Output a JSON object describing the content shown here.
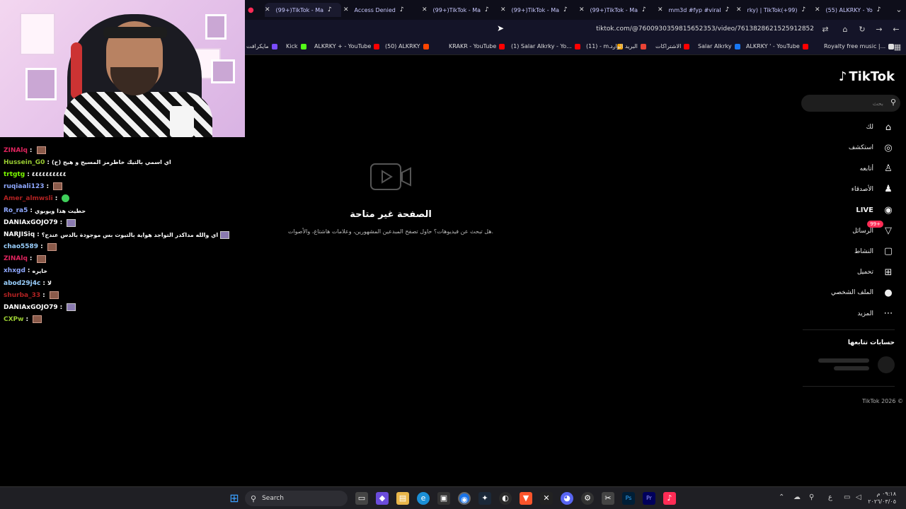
{
  "tabs": [
    {
      "label": "(99+)TikTok - Ma",
      "active": true
    },
    {
      "label": "Access Denied",
      "active": false
    },
    {
      "label": "(99+)TikTok - Ma",
      "active": false
    },
    {
      "label": "(99+)TikTok - Ma",
      "active": false
    },
    {
      "label": "(99+)TikTok - Ma",
      "active": false
    },
    {
      "label": "mm3d #fyp #viral",
      "active": false
    },
    {
      "label": "rky) | TikTok(+99)",
      "active": false
    },
    {
      "label": "(55) ALKRKY - Yo",
      "active": false
    }
  ],
  "url": "tiktok.com/@7600930359815652353/video/7613828621525912852",
  "bookmarks": [
    {
      "label": "مايكرافت",
      "color": "#7a4cff"
    },
    {
      "label": "Kick",
      "color": "#53fc18"
    },
    {
      "label": "ALKRKY + - YouTube",
      "color": "#ff0000"
    },
    {
      "label": "(50) ALKRKY",
      "color": "#ff4500"
    },
    {
      "label": "KRAKR - YouTube",
      "color": "#ff0000"
    },
    {
      "label": "(1) Salar Alkrky - Yo...",
      "color": "#ff0000"
    },
    {
      "label": "(11) - m...",
      "color": "#f4a100"
    },
    {
      "label": "البريد الوارد",
      "color": "#ea4335"
    },
    {
      "label": "الاشتراكات",
      "color": "#ff0000"
    },
    {
      "label": "Salar Alkrky",
      "color": "#1877f2"
    },
    {
      "label": "ALKRKY ' - YouTube",
      "color": "#ff0000"
    },
    {
      "label": "Royalty free music |...",
      "color": "#dddddd"
    }
  ],
  "tiktok": {
    "logo": "TikTok",
    "search_placeholder": "بحث",
    "nav": [
      {
        "label": "لك",
        "icon": "home-icon",
        "glyph": "⌂"
      },
      {
        "label": "استكشف",
        "icon": "compass-icon",
        "glyph": "◎"
      },
      {
        "label": "أتابعه",
        "icon": "user-follow-icon",
        "glyph": "♙"
      },
      {
        "label": "الأصدقاء",
        "icon": "friends-icon",
        "glyph": "♟"
      },
      {
        "label": "LIVE",
        "icon": "live-icon",
        "glyph": "◉"
      },
      {
        "label": "الرسائل",
        "icon": "messages-icon",
        "glyph": "▽",
        "badge": "99+"
      },
      {
        "label": "النشاط",
        "icon": "activity-icon",
        "glyph": "▢"
      },
      {
        "label": "تحميل",
        "icon": "upload-icon",
        "glyph": "⊞"
      },
      {
        "label": "الملف الشخصي",
        "icon": "profile-avatar-icon",
        "glyph": "●"
      },
      {
        "label": "المزيد",
        "icon": "more-icon",
        "glyph": "⋯"
      }
    ],
    "following_title": "حسابات تتابعها",
    "copyright": "TikTok 2026 ©",
    "unavailable_title": "الصفحة غير متاحة",
    "unavailable_sub": "هل تبحث عن فيديوهات؟ حاول تصفح المبدعين المشهورين، وعلامات هاشتاغ، والأصوات."
  },
  "chat": [
    {
      "user": "ZINAlq",
      "color": "#e0245e",
      "msg": "",
      "emote": "brown"
    },
    {
      "user": "Hussein_G0",
      "color": "#9acd32",
      "msg": "اي اسمي بالتيك خاطرمز المسيح و هيج (ح)",
      "emote": ""
    },
    {
      "user": "trtgtg",
      "color": "#7cfc00",
      "msg": "٤٤٤٤٤٤٤٤٤٤",
      "emote": ""
    },
    {
      "user": "ruqiaali123",
      "color": "#8fa8ff",
      "msg": "",
      "emote": "brown"
    },
    {
      "user": "Amer_almwsli",
      "color": "#b22222",
      "msg": "",
      "emote": "green"
    },
    {
      "user": "Ro_ra5",
      "color": "#8fa8ff",
      "msg": "حطيت هذا ويوبوي",
      "emote": ""
    },
    {
      "user": "DANIAxGOJO79",
      "color": "#ffffff",
      "msg": "",
      "emote": "purple"
    },
    {
      "user": "NARJISiq",
      "color": "#ffffff",
      "msg": "اي والله مداكدر التواجد هواية بالتيوت بس موجودة بالدس عندج؟",
      "emote": "purple"
    },
    {
      "user": "chao5589",
      "color": "#9ad0ff",
      "msg": "",
      "emote": "brown"
    },
    {
      "user": "ZINAlq",
      "color": "#e0245e",
      "msg": "",
      "emote": "brown"
    },
    {
      "user": "xhxgd",
      "color": "#8fa8ff",
      "msg": "خايره",
      "emote": ""
    },
    {
      "user": "abod29j4c",
      "color": "#9ad0ff",
      "msg": "لا",
      "emote": ""
    },
    {
      "user": "shurba_33",
      "color": "#b22222",
      "msg": "",
      "emote": "brown"
    },
    {
      "user": "DANIAxGOJO79",
      "color": "#ffffff",
      "msg": "",
      "emote": "purple"
    },
    {
      "user": "CXPw",
      "color": "#9acd32",
      "msg": "",
      "emote": "brown"
    }
  ],
  "taskbar": {
    "search_label": "Search",
    "time": "٠٩:١٨ م",
    "date": "٢٠٢٦/٠٣/٠٥",
    "lang": "ع"
  }
}
